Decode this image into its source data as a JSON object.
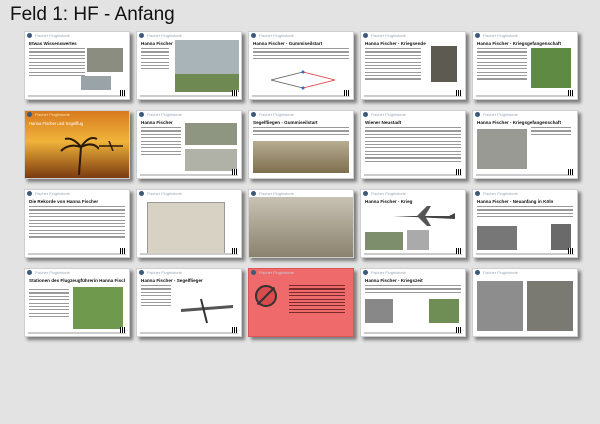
{
  "page_title": "Feld 1: HF - Anfang",
  "header_text": "Fischer Flughistorie",
  "cards": [
    {
      "title": "Etwas Wissenswertes",
      "kind": "text-photos"
    },
    {
      "title": "Hanna Fischer",
      "kind": "text-photo"
    },
    {
      "title": "Hanna Fischer - Gummiseilstart",
      "kind": "diagram"
    },
    {
      "title": "Hanna Fischer - Kriegsende",
      "kind": "text-portrait"
    },
    {
      "title": "Hanna Fischer - Kriegsgefangenschaft",
      "kind": "text-map"
    },
    {
      "title": "Hanna Fischer und Segelflug",
      "kind": "sunset"
    },
    {
      "title": "Hanna Fischer",
      "kind": "text-photos"
    },
    {
      "title": "Segelfliegen - Gummiseilstart",
      "kind": "photo"
    },
    {
      "title": "Wiener Neustadt",
      "kind": "text"
    },
    {
      "title": "Hanna Fischer - Kriegsgefangenschaft",
      "kind": "text-photo"
    },
    {
      "title": "Die Rekorde von Hanna Fischer",
      "kind": "text"
    },
    {
      "title": "",
      "kind": "postcard"
    },
    {
      "title": "",
      "kind": "glider-photo"
    },
    {
      "title": "Hanna Fischer - Krieg",
      "kind": "aircraft"
    },
    {
      "title": "Hanna Fischer - Neuanfang in Köln",
      "kind": "text-photos"
    },
    {
      "title": "Stationen des Flugzeugführerin Hanna Fischer",
      "kind": "map"
    },
    {
      "title": "Hanna Fischer - Segelflieger",
      "kind": "plane"
    },
    {
      "title": "",
      "kind": "red"
    },
    {
      "title": "Hanna Fischer - Kriegszeit",
      "kind": "text-photos"
    },
    {
      "title": "",
      "kind": "photos"
    }
  ]
}
